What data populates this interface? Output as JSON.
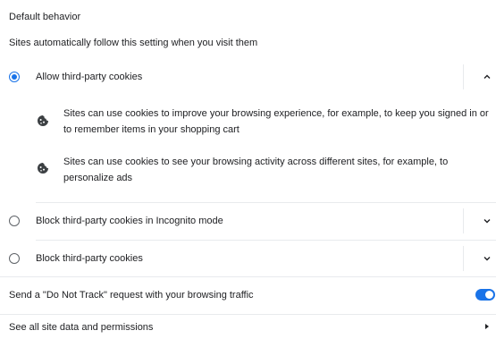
{
  "default_behavior": {
    "title": "Default behavior",
    "subtitle": "Sites automatically follow this setting when you visit them"
  },
  "options": [
    {
      "label": "Allow third-party cookies",
      "selected": true,
      "expanded": true,
      "details": [
        "Sites can use cookies to improve your browsing experience, for example, to keep you signed in or to remember items in your shopping cart",
        "Sites can use cookies to see your browsing activity across different sites, for example, to personalize ads"
      ]
    },
    {
      "label": "Block third-party cookies in Incognito mode",
      "selected": false,
      "expanded": false
    },
    {
      "label": "Block third-party cookies",
      "selected": false,
      "expanded": false
    }
  ],
  "do_not_track": {
    "label": "Send a \"Do Not Track\" request with your browsing traffic",
    "enabled": true
  },
  "see_all": {
    "label": "See all site data and permissions"
  },
  "colors": {
    "accent": "#1a73e8",
    "separator": "#e8eaed"
  },
  "icons": {
    "radio": "radio-button",
    "expand": "chevron-down-icon",
    "collapse": "chevron-up-icon",
    "cookie": "cookie-icon",
    "navigate": "arrow-right-icon"
  }
}
